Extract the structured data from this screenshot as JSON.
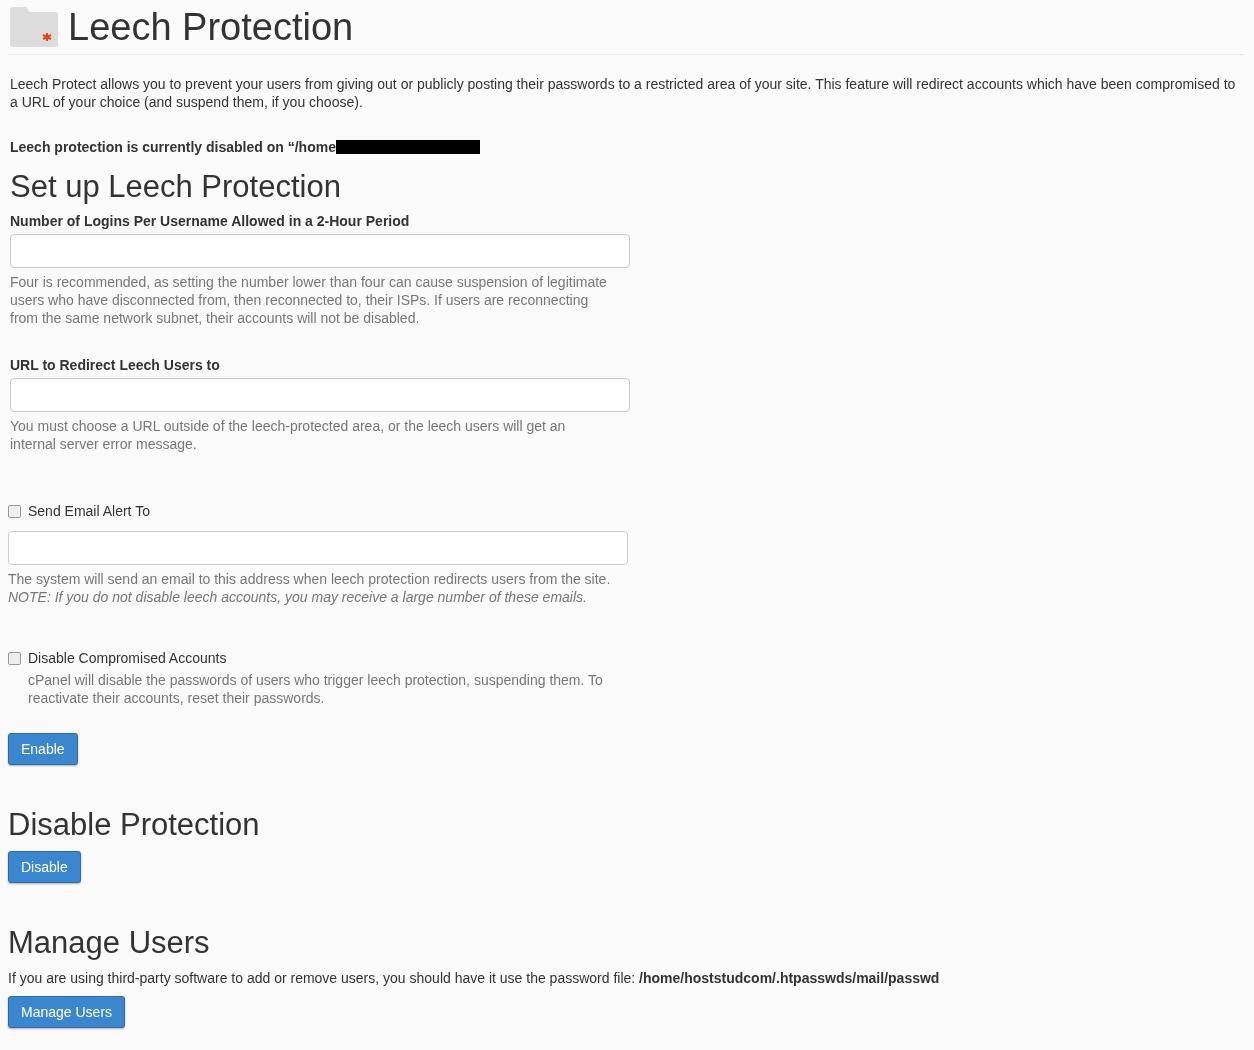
{
  "header": {
    "title": "Leech Protection"
  },
  "intro": "Leech Protect allows you to prevent your users from giving out or publicly posting their passwords to a restricted area of your site. This feature will redirect accounts which have been compromised to a URL of your choice (and suspend them, if you choose).",
  "status": "Leech protection is currently disabled on “/home",
  "setup": {
    "heading": "Set up Leech Protection",
    "fields": [
      {
        "kind": "labeled",
        "label": "Number of Logins Per Username Allowed in a 2-Hour Period",
        "help": "Four is recommended, as setting the number lower than four can cause suspension of legitimate users who have disconnected from, then reconnected to, their ISPs. If users are reconnecting from the same network subnet, their accounts will not be disabled."
      },
      {
        "kind": "labeled",
        "label": "URL to Redirect Leech Users to",
        "help": "You must choose a URL outside of the leech-protected area, or the leech users will get an internal server error message."
      },
      {
        "kind": "checkbox-field",
        "label": "Send Email Alert To",
        "checked": false,
        "help": "The system will send an email to this address when leech protection redirects users from the site. *NOTE: If you do not disable leech accounts, you may receive a large number of these emails.*"
      },
      {
        "kind": "checkbox",
        "label": "Disable Compromised Accounts",
        "checked": false,
        "help": "cPanel will disable the passwords of users who trigger leech protection, suspending them. To reactivate their accounts, reset their passwords."
      }
    ],
    "button": "Enable"
  },
  "disable": {
    "heading": "Disable Protection",
    "button": "Disable"
  },
  "manage": {
    "heading": "Manage Users",
    "text": "If you are using third-party software to add or remove users, you should have it use the password file: **/home/hoststudcom/.htpasswds/mail/passwd**",
    "button": "Manage Users"
  }
}
